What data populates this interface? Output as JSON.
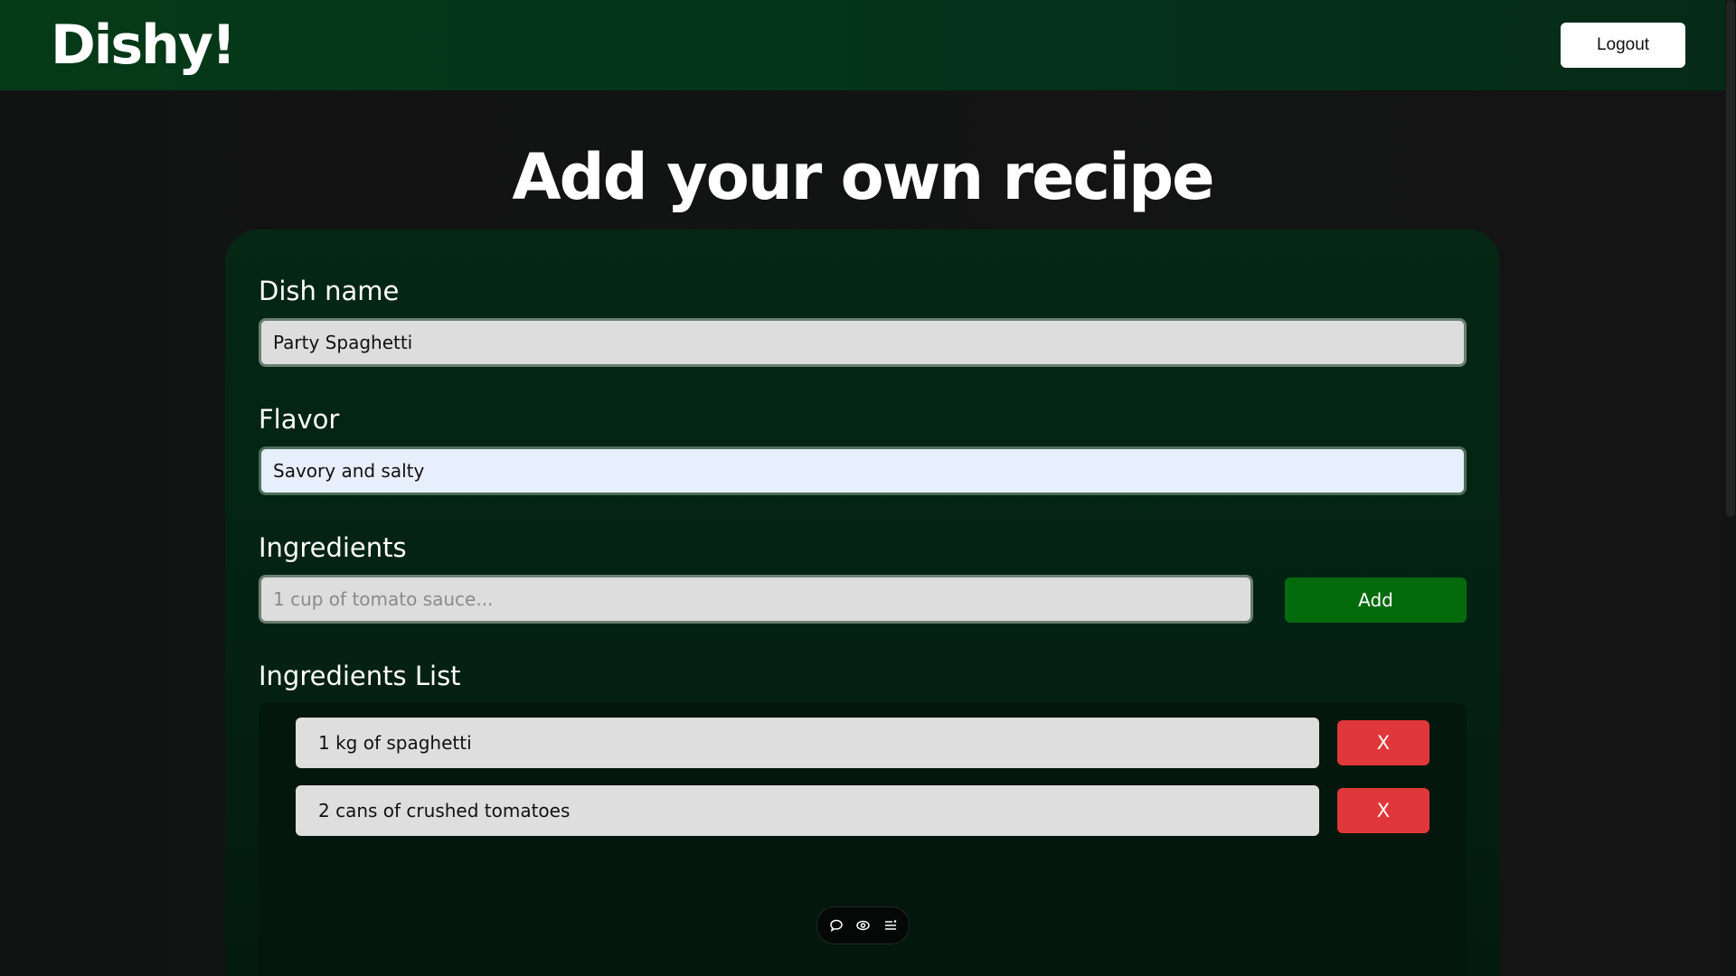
{
  "app": {
    "logo_text": "Dishy!",
    "logout_label": "Logout"
  },
  "page": {
    "title": "Add your own recipe"
  },
  "form": {
    "dish_name": {
      "label": "Dish name",
      "value": "Party Spaghetti"
    },
    "flavor": {
      "label": "Flavor",
      "value": "Savory and salty"
    },
    "ingredients": {
      "label": "Ingredients",
      "placeholder": "1 cup of tomato sauce...",
      "value": "",
      "add_label": "Add"
    },
    "ingredients_list": {
      "label": "Ingredients List",
      "items": [
        {
          "text": "1 kg of spaghetti",
          "remove_label": "X"
        },
        {
          "text": "2 cans of crushed tomatoes",
          "remove_label": "X"
        }
      ]
    }
  },
  "toolbar": {
    "icons": [
      "comment-icon",
      "eye-icon",
      "list-icon"
    ]
  },
  "colors": {
    "brand_green": "#053a18",
    "add_button": "#046a0c",
    "remove_button": "#e0383a",
    "autofill_bg": "#e7eefc"
  }
}
